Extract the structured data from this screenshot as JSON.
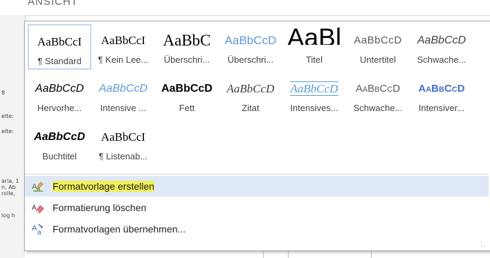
{
  "window": {
    "title": "ANSICHT"
  },
  "left_fragments": [
    "8",
    "elte:",
    "elte:",
    "aria, 1",
    "n, Ab",
    "rolle,",
    "log h"
  ],
  "gallery": {
    "styles": [
      {
        "preview": "AaBbCcI",
        "name": "¶ Standard",
        "variant": "standard",
        "selected": true
      },
      {
        "preview": "AaBbCcI",
        "name": "¶ Kein Lee...",
        "variant": "kein"
      },
      {
        "preview": "AaBbC",
        "name": "Überschri...",
        "variant": "ueb1"
      },
      {
        "preview": "AaBbCcD",
        "name": "Überschri...",
        "variant": "ueb2"
      },
      {
        "preview": "AaBl",
        "name": "Titel",
        "variant": "titel"
      },
      {
        "preview": "AaBbCcD",
        "name": "Untertitel",
        "variant": "untertitel"
      },
      {
        "preview": "AaBbCcD",
        "name": "Schwache...",
        "variant": "schwache"
      },
      {
        "preview": "AaBbCcD",
        "name": "Hervorhe...",
        "variant": "hervor"
      },
      {
        "preview": "AaBbCcD",
        "name": "Intensive ...",
        "variant": "intens"
      },
      {
        "preview": "AaBbCcD",
        "name": "Fett",
        "variant": "fett"
      },
      {
        "preview": "AaBbCcD",
        "name": "Zitat",
        "variant": "zitat"
      },
      {
        "preview": "AaBbCcD",
        "name": "Intensives...",
        "variant": "intzitat"
      },
      {
        "preview": "AaBbCcD",
        "name": "Schwache...",
        "variant": "schwachverw"
      },
      {
        "preview": "AaBbCcD",
        "name": "Intensiver...",
        "variant": "intverw"
      },
      {
        "preview": "AaBbCcD",
        "name": "Buchtitel",
        "variant": "buch"
      },
      {
        "preview": "AaBbCcI",
        "name": "¶ Listenab...",
        "variant": "liste"
      }
    ]
  },
  "menu": {
    "create": {
      "label": "Formatvorlage erstellen",
      "icon": "create-style-icon",
      "hovered": true
    },
    "clear": {
      "label": "Formatierung löschen",
      "icon": "eraser-icon"
    },
    "apply": {
      "label": "Formatvorlagen übernehmen...",
      "icon": "apply-styles-icon"
    }
  },
  "colors": {
    "accent_blue": "#5b9bd5",
    "hover_bg": "#dfe8f6",
    "highlight": "#f1f15a",
    "selection_border": "#c3d6ef"
  }
}
